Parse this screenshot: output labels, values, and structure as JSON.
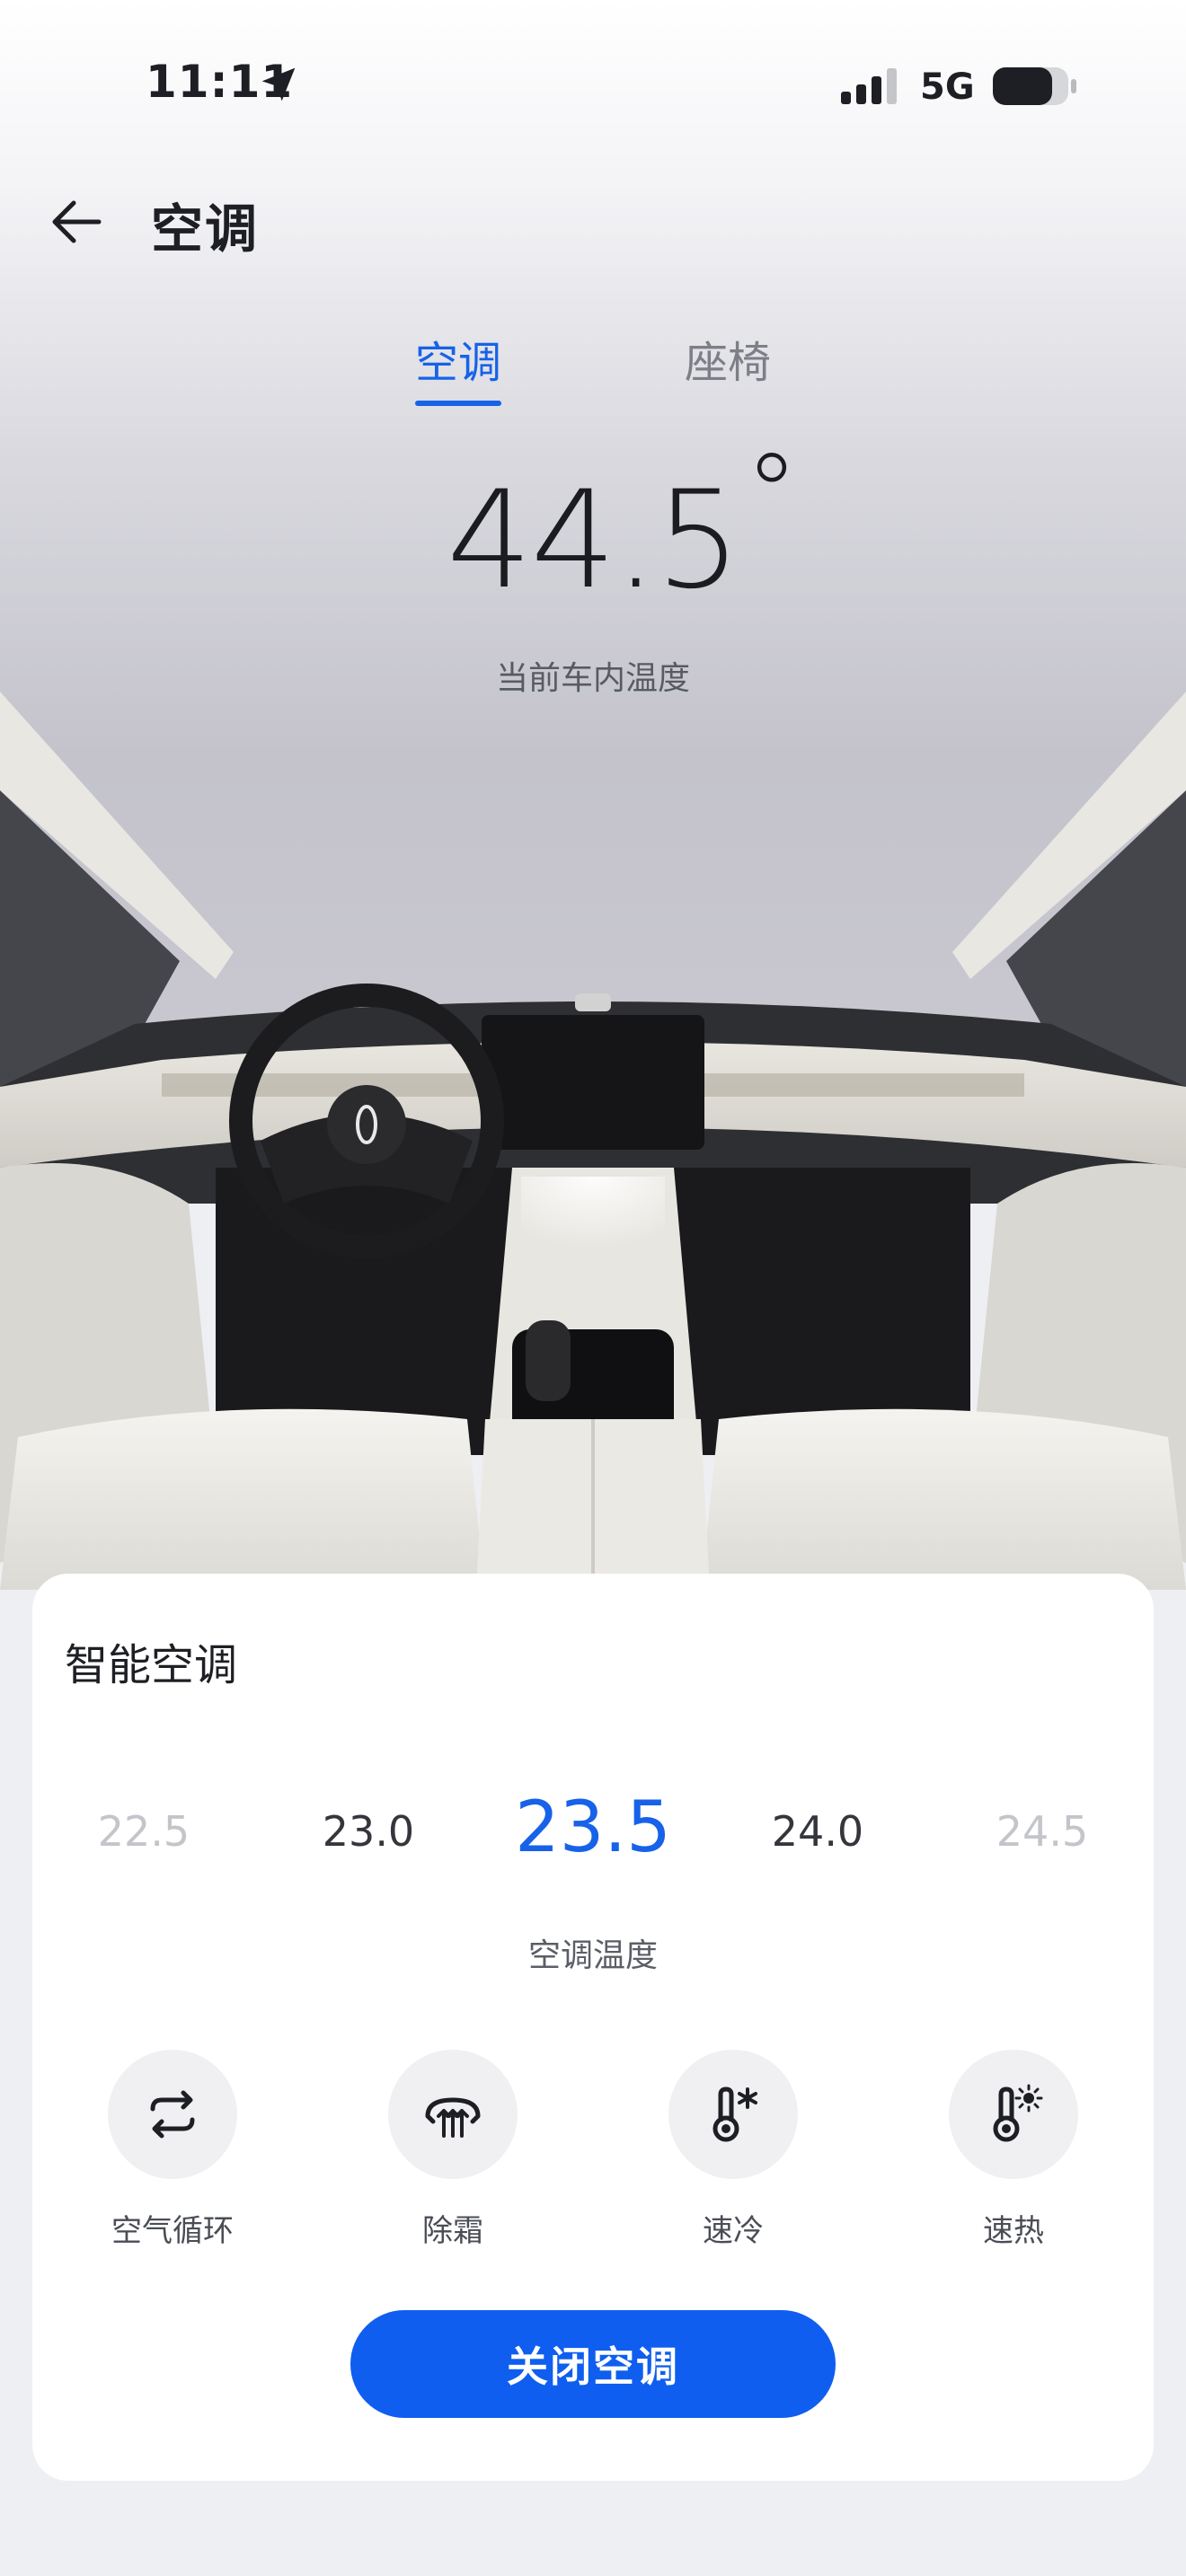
{
  "status_bar": {
    "time": "11:11",
    "network": "5G"
  },
  "header": {
    "title": "空调"
  },
  "tabs": [
    {
      "label": "空调",
      "active": true
    },
    {
      "label": "座椅",
      "active": false
    }
  ],
  "cabin": {
    "temperature": "44.5",
    "degree_symbol": "°",
    "label": "当前车内温度"
  },
  "smart_ac": {
    "title": "智能空调",
    "temperature_options": [
      "22.5",
      "23.0",
      "23.5",
      "24.0",
      "24.5"
    ],
    "selected_temperature": "23.5",
    "temperature_label": "空调温度",
    "functions": [
      {
        "label": "空气循环",
        "icon": "air-cycle-icon"
      },
      {
        "label": "除霜",
        "icon": "defrost-icon"
      },
      {
        "label": "速冷",
        "icon": "quick-cool-icon"
      },
      {
        "label": "速热",
        "icon": "quick-heat-icon"
      }
    ],
    "close_button": "关闭空调"
  },
  "colors": {
    "accent": "#1762e8",
    "button": "#0f5ef0",
    "card": "#ffffff"
  }
}
